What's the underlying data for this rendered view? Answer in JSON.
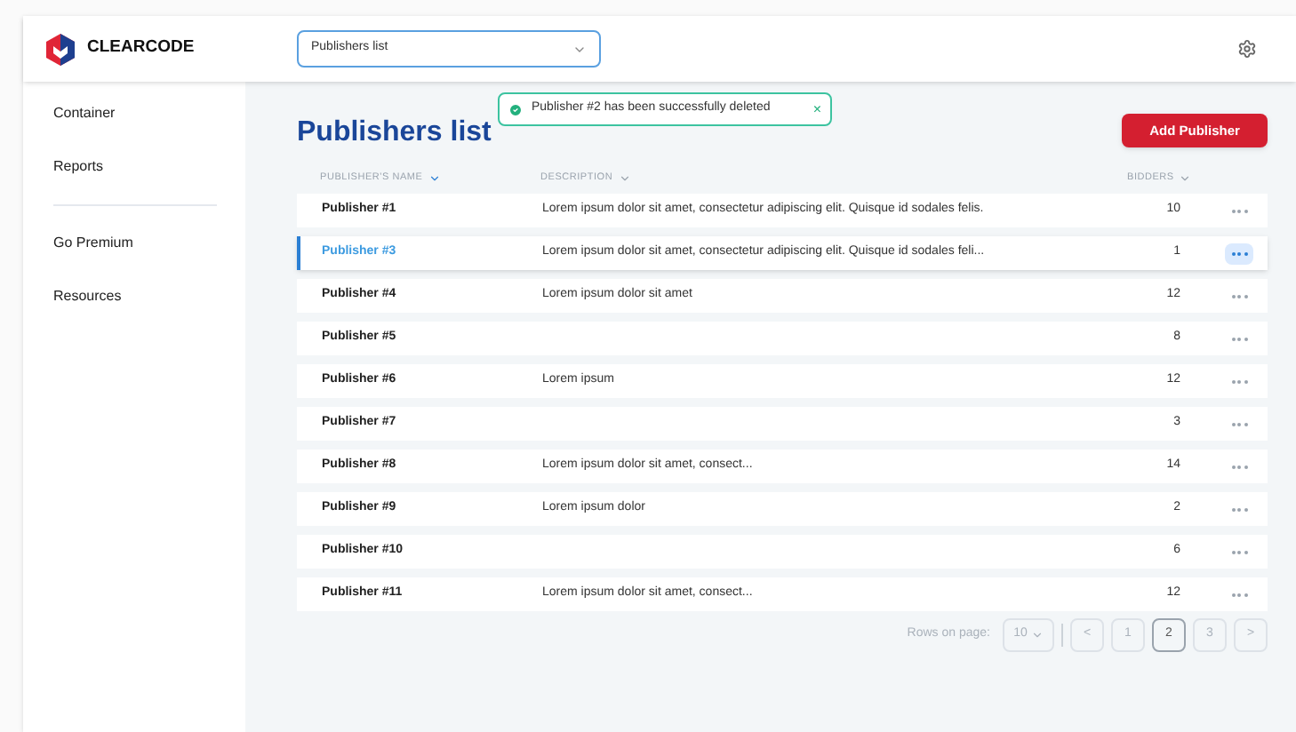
{
  "brand": {
    "name": "CLEARCODE"
  },
  "page_select": {
    "value": "Publishers list"
  },
  "sidebar": {
    "sections": [
      {
        "items": [
          {
            "label": "Container"
          },
          {
            "label": "Reports"
          }
        ]
      },
      {
        "items": [
          {
            "label": "Go Premium"
          },
          {
            "label": "Resources"
          }
        ]
      }
    ]
  },
  "toast": {
    "message": "Publisher #2 has been successfully deleted",
    "close": "×"
  },
  "title": "Publishers list",
  "add_button": "Add Publisher",
  "table": {
    "columns": [
      "PUBLISHER'S NAME",
      "DESCRIPTION",
      "BIDDERS"
    ],
    "rows": [
      {
        "name": "Publisher #1",
        "description": "Lorem ipsum dolor sit amet, consectetur adipiscing elit. Quisque id sodales felis.",
        "bidders": "10",
        "selected": false
      },
      {
        "name": "Publisher #3",
        "description": "Lorem ipsum dolor sit amet, consectetur adipiscing elit. Quisque id sodales feli...",
        "bidders": "1",
        "selected": true
      },
      {
        "name": "Publisher #4",
        "description": "Lorem ipsum dolor sit amet",
        "bidders": "12",
        "selected": false
      },
      {
        "name": "Publisher #5",
        "description": "",
        "bidders": "8",
        "selected": false
      },
      {
        "name": "Publisher #6",
        "description": "Lorem ipsum",
        "bidders": "12",
        "selected": false
      },
      {
        "name": "Publisher #7",
        "description": "",
        "bidders": "3",
        "selected": false
      },
      {
        "name": "Publisher #8",
        "description": "Lorem ipsum dolor sit amet, consect...",
        "bidders": "14",
        "selected": false
      },
      {
        "name": "Publisher #9",
        "description": "Lorem ipsum dolor",
        "bidders": "2",
        "selected": false
      },
      {
        "name": "Publisher #10",
        "description": "",
        "bidders": "6",
        "selected": false
      },
      {
        "name": "Publisher #11",
        "description": "Lorem ipsum dolor sit amet, consect...",
        "bidders": "12",
        "selected": false
      }
    ]
  },
  "pagination": {
    "rows_label": "Rows on page:",
    "rows_value": "10",
    "prev": "<",
    "next": ">",
    "pages": [
      {
        "label": "1",
        "selected": false
      },
      {
        "label": "2",
        "selected": true
      },
      {
        "label": "3",
        "selected": false
      }
    ]
  }
}
